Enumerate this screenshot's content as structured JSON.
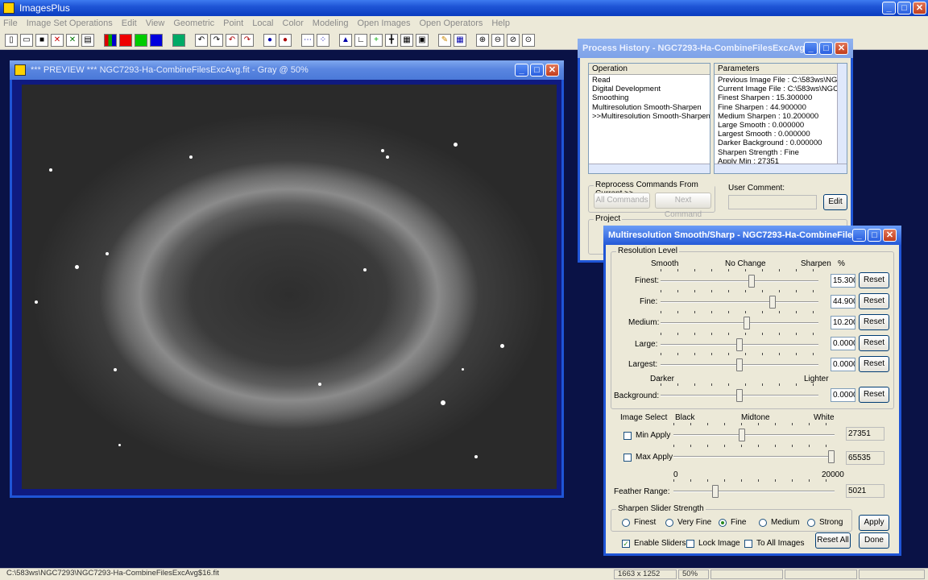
{
  "app_title": "ImagesPlus",
  "menu": [
    "File",
    "Image Set Operations",
    "Edit",
    "View",
    "Geometric",
    "Point",
    "Local",
    "Color",
    "Modeling",
    "Open Images",
    "Open Operators",
    "Help"
  ],
  "preview": {
    "title": "*** PREVIEW *** NGC7293-Ha-CombineFilesExcAvg.fit - Gray @ 50%"
  },
  "history": {
    "title": "Process History - NGC7293-Ha-CombineFilesExcAvg$...",
    "operation_header": "Operation",
    "operations": [
      "Read",
      "Digital Development",
      "Smoothing",
      "Multiresolution Smooth-Sharpen",
      ">>Multiresolution Smooth-Sharpen"
    ],
    "parameters_header": "Parameters",
    "parameters": [
      "Previous Image File : C:\\583ws\\NGC7",
      "Current Image File : C:\\583ws\\NGC72",
      "Finest Sharpen : 15.300000",
      "Fine Sharpen : 44.900000",
      "Medium Sharpen : 10.200000",
      "Large Smooth : 0.000000",
      "Largest Smooth : 0.000000",
      "Darker Background : 0.000000",
      "Sharpen Strength : Fine",
      "Apply Min : 27351"
    ],
    "reprocess_label": "Reprocess Commands From Current >>",
    "all_commands": "All Commands",
    "next_command": "Next Command",
    "user_comment_label": "User Comment:",
    "edit": "Edit",
    "project_label": "Project"
  },
  "msm": {
    "title": "Multiresolution Smooth/Sharp - NGC7293-Ha-CombineFiles...",
    "resolution_level": "Resolution Level",
    "col_smooth": "Smooth",
    "col_nochange": "No Change",
    "col_sharpen": "Sharpen",
    "col_pct": "%",
    "reset": "Reset",
    "rows": [
      {
        "label": "Finest:",
        "value": "15.3000",
        "level": 0.58
      },
      {
        "label": "Fine:",
        "value": "44.9000",
        "level": 0.72
      },
      {
        "label": "Medium:",
        "value": "10.2000",
        "level": 0.55
      },
      {
        "label": "Large:",
        "value": "0.0000",
        "level": 0.5
      },
      {
        "label": "Largest:",
        "value": "0.0000",
        "level": 0.5
      }
    ],
    "darker": "Darker",
    "lighter": "Lighter",
    "background": {
      "label": "Background:",
      "value": "0.0000",
      "level": 0.5
    },
    "image_select": "Image Select",
    "black": "Black",
    "midtone": "Midtone",
    "white": "White",
    "min_apply": {
      "label": "Min Apply",
      "value": "27351",
      "level": 0.42
    },
    "max_apply": {
      "label": "Max Apply",
      "value": "65535",
      "level": 1.0
    },
    "feather_zero": "0",
    "feather_max": "20000",
    "feather": {
      "label": "Feather Range:",
      "value": "5021",
      "level": 0.25
    },
    "strength_label": "Sharpen Slider Strength",
    "strengths": [
      "Finest",
      "Very Fine",
      "Fine",
      "Medium",
      "Strong"
    ],
    "strength_selected": "Fine",
    "apply": "Apply",
    "enable_sliders": "Enable Sliders",
    "lock_image": "Lock Image",
    "to_all_images": "To All Images",
    "reset_all": "Reset All",
    "done": "Done"
  },
  "status": {
    "path": "C:\\583ws\\NGC7293\\NGC7293-Ha-CombineFilesExcAvg$16.fit",
    "size": "1663 x 1252",
    "zoom": "50%"
  }
}
